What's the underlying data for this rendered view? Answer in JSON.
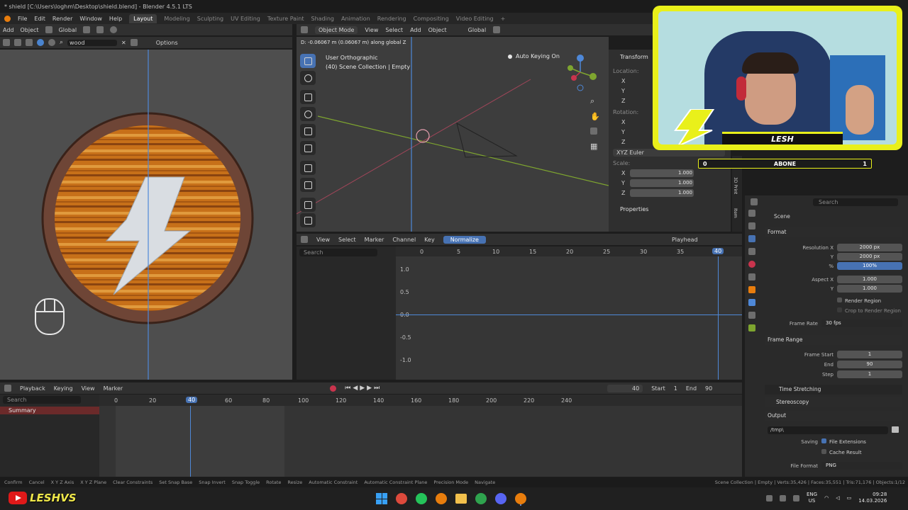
{
  "title_bar": {
    "title": "* shield [C:\\Users\\loghm\\Desktop\\shield.blend] - Blender 4.5.1 LTS",
    "menus": [
      "File",
      "Edit",
      "Render",
      "Window",
      "Help"
    ],
    "workspaces": [
      "Layout",
      "Modeling",
      "Sculpting",
      "UV Editing",
      "Texture Paint",
      "Shading",
      "Animation",
      "Rendering",
      "Compositing",
      "Video Editing"
    ],
    "active_workspace": "Layout",
    "add_tab": "+"
  },
  "left_header": {
    "add": "Add",
    "object": "Object",
    "global": "Global",
    "search_value": "wood",
    "options": "Options"
  },
  "viewport_header": {
    "mode": "Object Mode",
    "menus": [
      "View",
      "Select",
      "Add",
      "Object"
    ],
    "global": "Global",
    "status": "D: -0.06067 m (0.06067 m) along global Z",
    "view_name": "User Orthographic",
    "collection": "(40) Scene Collection | Empty",
    "auto_keying": "Auto Keying On"
  },
  "transform_panel": {
    "title": "Transform",
    "location": "Location:",
    "rotation": "Rotation:",
    "euler": "XYZ Euler",
    "scale": "Scale:",
    "axes": [
      "X",
      "Y",
      "Z"
    ],
    "scale_values": [
      "1.000",
      "1.000",
      "1.000"
    ],
    "properties": "Properties",
    "side_tabs": [
      "3D Print",
      "Item"
    ]
  },
  "graph_editor": {
    "menus": [
      "View",
      "Select",
      "Marker",
      "Channel",
      "Key"
    ],
    "normalize": "Normalize",
    "playhead": "Playhead",
    "search_placeholder": "Search",
    "x_ticks": [
      "0",
      "5",
      "10",
      "15",
      "20",
      "25",
      "30",
      "35",
      "40"
    ],
    "y_ticks": [
      "1.0",
      "0.5",
      "0.0",
      "-0.5",
      "-1.0"
    ],
    "current_frame": "40"
  },
  "timeline": {
    "menus": [
      "Playback",
      "Keying",
      "View",
      "Marker"
    ],
    "search_placeholder": "Search",
    "summary": "Summary",
    "ticks": [
      "0",
      "20",
      "40",
      "60",
      "80",
      "100",
      "120",
      "140",
      "160",
      "180",
      "200",
      "220",
      "240"
    ],
    "current_frame": "40",
    "start_label": "Start",
    "start": "1",
    "end_label": "End",
    "end": "90"
  },
  "properties_panel": {
    "search_placeholder": "Search",
    "scene": "Scene",
    "format": "Format",
    "resolution_x_label": "Resolution X",
    "resolution_x": "2000 px",
    "resolution_y_label": "Y",
    "resolution_y": "2000 px",
    "percent_label": "%",
    "percent": "100%",
    "aspect_x_label": "Aspect X",
    "aspect_x": "1.000",
    "aspect_y_label": "Y",
    "aspect_y": "1.000",
    "render_region": "Render Region",
    "crop": "Crop to Render Region",
    "frame_rate_label": "Frame Rate",
    "frame_rate": "30 fps",
    "frame_range": "Frame Range",
    "frame_start_label": "Frame Start",
    "frame_start": "1",
    "end_label": "End",
    "end": "90",
    "step_label": "Step",
    "step": "1",
    "time_stretching": "Time Stretching",
    "stereoscopy": "Stereoscopy",
    "output": "Output",
    "output_path": "/tmp\\",
    "saving_label": "Saving",
    "file_extensions": "File Extensions",
    "cache_result": "Cache Result",
    "file_format_label": "File Format",
    "file_format": "PNG"
  },
  "status_bar": {
    "items": [
      "Confirm",
      "Cancel",
      "X Y Z Axis",
      "X Y Z Plane",
      "Clear Constraints",
      "Set Snap Base",
      "Snap Invert",
      "Snap Toggle",
      "Rotate",
      "Resize",
      "Automatic Constraint",
      "Automatic Constraint Plane",
      "Precision Mode",
      "Navigate"
    ],
    "stats": "Scene Collection | Empty | Verts:35,426 | Faces:35,551 | Tris:71,176 | Objects:1/12"
  },
  "webcam": {
    "name": "LESH",
    "counter_left": "0",
    "counter_label": "ABONE",
    "counter_right": "1"
  },
  "channel_logo": "LESHVS",
  "taskbar": {
    "lang_top": "ENG",
    "lang_bottom": "US",
    "time": "09:28",
    "date": "14.03.2026"
  },
  "colors": {
    "accent_blue": "#4772b3",
    "playhead_blue": "#4e88d8",
    "wood_orange": "#c8781e",
    "webcam_yellow": "#e9f01a",
    "summary_red": "#6b2a2a"
  }
}
